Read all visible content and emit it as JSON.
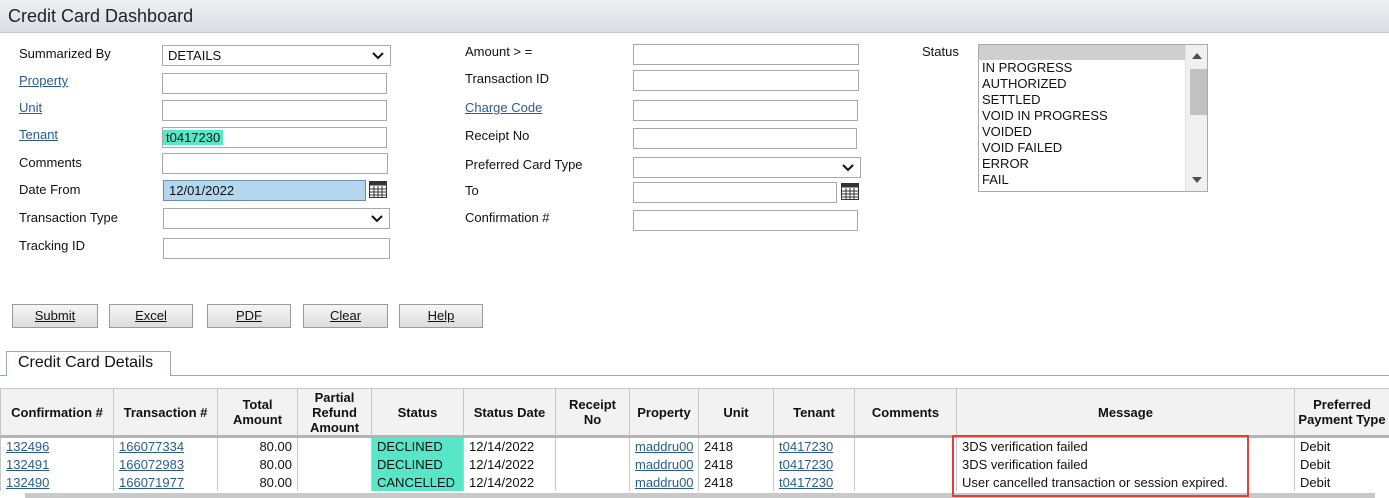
{
  "title": "Credit Card Dashboard",
  "filters": {
    "summarized_by_label": "Summarized By",
    "summarized_by_value": "DETAILS",
    "property_label": "Property",
    "unit_label": "Unit",
    "tenant_label": "Tenant",
    "tenant_value": "t0417230",
    "comments_label": "Comments",
    "date_from_label": "Date From",
    "date_from_value": "12/01/2022",
    "transaction_type_label": "Transaction Type",
    "tracking_id_label": "Tracking ID",
    "amount_label": "Amount > =",
    "transaction_id_label": "Transaction ID",
    "charge_code_label": "Charge Code",
    "receipt_no_label": "Receipt No",
    "preferred_card_type_label": "Preferred Card Type",
    "to_label": "To",
    "confirmation_label": "Confirmation #",
    "status_label": "Status",
    "status_options": [
      "",
      "IN PROGRESS",
      "AUTHORIZED",
      "SETTLED",
      "VOID IN PROGRESS",
      "VOIDED",
      "VOID FAILED",
      "ERROR",
      "FAIL"
    ]
  },
  "buttons": {
    "submit": "Submit",
    "excel": "Excel",
    "pdf": "PDF",
    "clear": "Clear",
    "help": "Help"
  },
  "tab_label": "Credit Card Details",
  "table": {
    "headers": [
      "Confirmation #",
      "Transaction #",
      "Total Amount",
      "Partial Refund Amount",
      "Status",
      "Status Date",
      "Receipt No",
      "Property",
      "Unit",
      "Tenant",
      "Comments",
      "Message",
      "Preferred Payment Type"
    ],
    "rows": [
      {
        "confirmation": "132496",
        "transaction": "166077334",
        "total": "80.00",
        "partial": "",
        "status": "DECLINED",
        "status_date": "12/14/2022",
        "receipt": "",
        "property": "maddru00",
        "unit": "2418",
        "tenant": "t0417230",
        "comments": "",
        "message": "3DS verification failed",
        "payment_type": "Debit"
      },
      {
        "confirmation": "132491",
        "transaction": "166072983",
        "total": "80.00",
        "partial": "",
        "status": "DECLINED",
        "status_date": "12/14/2022",
        "receipt": "",
        "property": "maddru00",
        "unit": "2418",
        "tenant": "t0417230",
        "comments": "",
        "message": "3DS verification failed",
        "payment_type": "Debit"
      },
      {
        "confirmation": "132490",
        "transaction": "166071977",
        "total": "80.00",
        "partial": "",
        "status": "CANCELLED",
        "status_date": "12/14/2022",
        "receipt": "",
        "property": "maddru00",
        "unit": "2418",
        "tenant": "t0417230",
        "comments": "",
        "message": "User cancelled transaction or session expired.",
        "payment_type": "Debit"
      }
    ]
  },
  "colors": {
    "highlight_green": "#57e6c7",
    "date_blue": "#b5d7ee",
    "link_blue": "#2b5d8c",
    "annotation_red": "#e0403a"
  }
}
